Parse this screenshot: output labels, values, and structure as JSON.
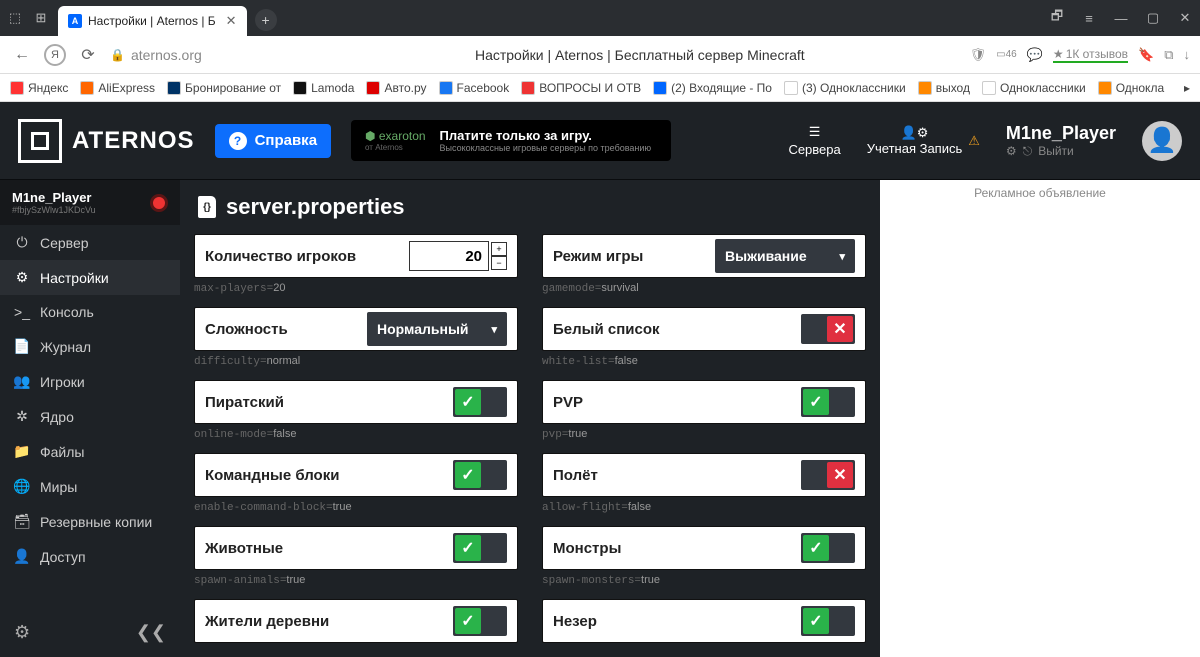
{
  "browser": {
    "tab_title": "Настройки | Aternos | Б",
    "url": "aternos.org",
    "page_title": "Настройки | Aternos | Бесплатный сервер Minecraft",
    "rating": "1К отзывов"
  },
  "bookmarks": [
    {
      "label": "Яндекс",
      "color": "#f33"
    },
    {
      "label": "AliExpress",
      "color": "#f60"
    },
    {
      "label": "Бронирование от",
      "color": "#036"
    },
    {
      "label": "Lamoda",
      "color": "#111"
    },
    {
      "label": "Авто.ру",
      "color": "#d00"
    },
    {
      "label": "Facebook",
      "color": "#1877f2"
    },
    {
      "label": "ВОПРОСЫ И ОТВ",
      "color": "#e33"
    },
    {
      "label": "(2) Входящие - По",
      "color": "#06f"
    },
    {
      "label": "(3) Одноклассники",
      "color": "#fff"
    },
    {
      "label": "выход",
      "color": "#f80"
    },
    {
      "label": "Одноклассники",
      "color": "#fff"
    },
    {
      "label": "Однокла",
      "color": "#f80"
    }
  ],
  "header": {
    "brand": "ATERNOS",
    "help": "Справка",
    "banner_brand": "exaroton",
    "banner_from": "от Aternos",
    "banner_title": "Платите только за игру.",
    "banner_sub": "Высококлассные игровые серверы по требованию",
    "servers": "Сервера",
    "account": "Учетная Запись",
    "username": "M1ne_Player",
    "signout": "Выйти"
  },
  "sidebar": {
    "user": "M1ne_Player",
    "id": "#fbjySzWlw1JKDcVu",
    "items": [
      {
        "icon": "⏻",
        "label": "Сервер"
      },
      {
        "icon": "⚙",
        "label": "Настройки"
      },
      {
        "icon": ">_",
        "label": "Консоль"
      },
      {
        "icon": "📄",
        "label": "Журнал"
      },
      {
        "icon": "👥",
        "label": "Игроки"
      },
      {
        "icon": "✲",
        "label": "Ядро"
      },
      {
        "icon": "📁",
        "label": "Файлы"
      },
      {
        "icon": "🌐",
        "label": "Миры"
      },
      {
        "icon": "🗃",
        "label": "Резервные копии"
      },
      {
        "icon": "👤",
        "label": "Доступ"
      }
    ]
  },
  "panel": {
    "title": "server.properties"
  },
  "properties": {
    "max_players": {
      "label": "Количество игроков",
      "value": "20",
      "code": "max-players=",
      "code_val": "20"
    },
    "gamemode": {
      "label": "Режим игры",
      "value": "Выживание",
      "code": "gamemode=",
      "code_val": "survival"
    },
    "difficulty": {
      "label": "Сложность",
      "value": "Нормальный",
      "code": "difficulty=",
      "code_val": "normal"
    },
    "whitelist": {
      "label": "Белый список",
      "on": false,
      "code": "white-list=",
      "code_val": "false"
    },
    "online_mode": {
      "label": "Пиратский",
      "on": true,
      "code": "online-mode=",
      "code_val": "false"
    },
    "pvp": {
      "label": "PVP",
      "on": true,
      "code": "pvp=",
      "code_val": "true"
    },
    "command_blocks": {
      "label": "Командные блоки",
      "on": true,
      "code": "enable-command-block=",
      "code_val": "true"
    },
    "flight": {
      "label": "Полёт",
      "on": false,
      "code": "allow-flight=",
      "code_val": "false"
    },
    "animals": {
      "label": "Животные",
      "on": true,
      "code": "spawn-animals=",
      "code_val": "true"
    },
    "monsters": {
      "label": "Монстры",
      "on": true,
      "code": "spawn-monsters=",
      "code_val": "true"
    },
    "villagers": {
      "label": "Жители деревни",
      "on": true,
      "code": "",
      "code_val": ""
    },
    "nether": {
      "label": "Незер",
      "on": true,
      "code": "",
      "code_val": ""
    }
  },
  "ad_label": "Рекламное объявление"
}
